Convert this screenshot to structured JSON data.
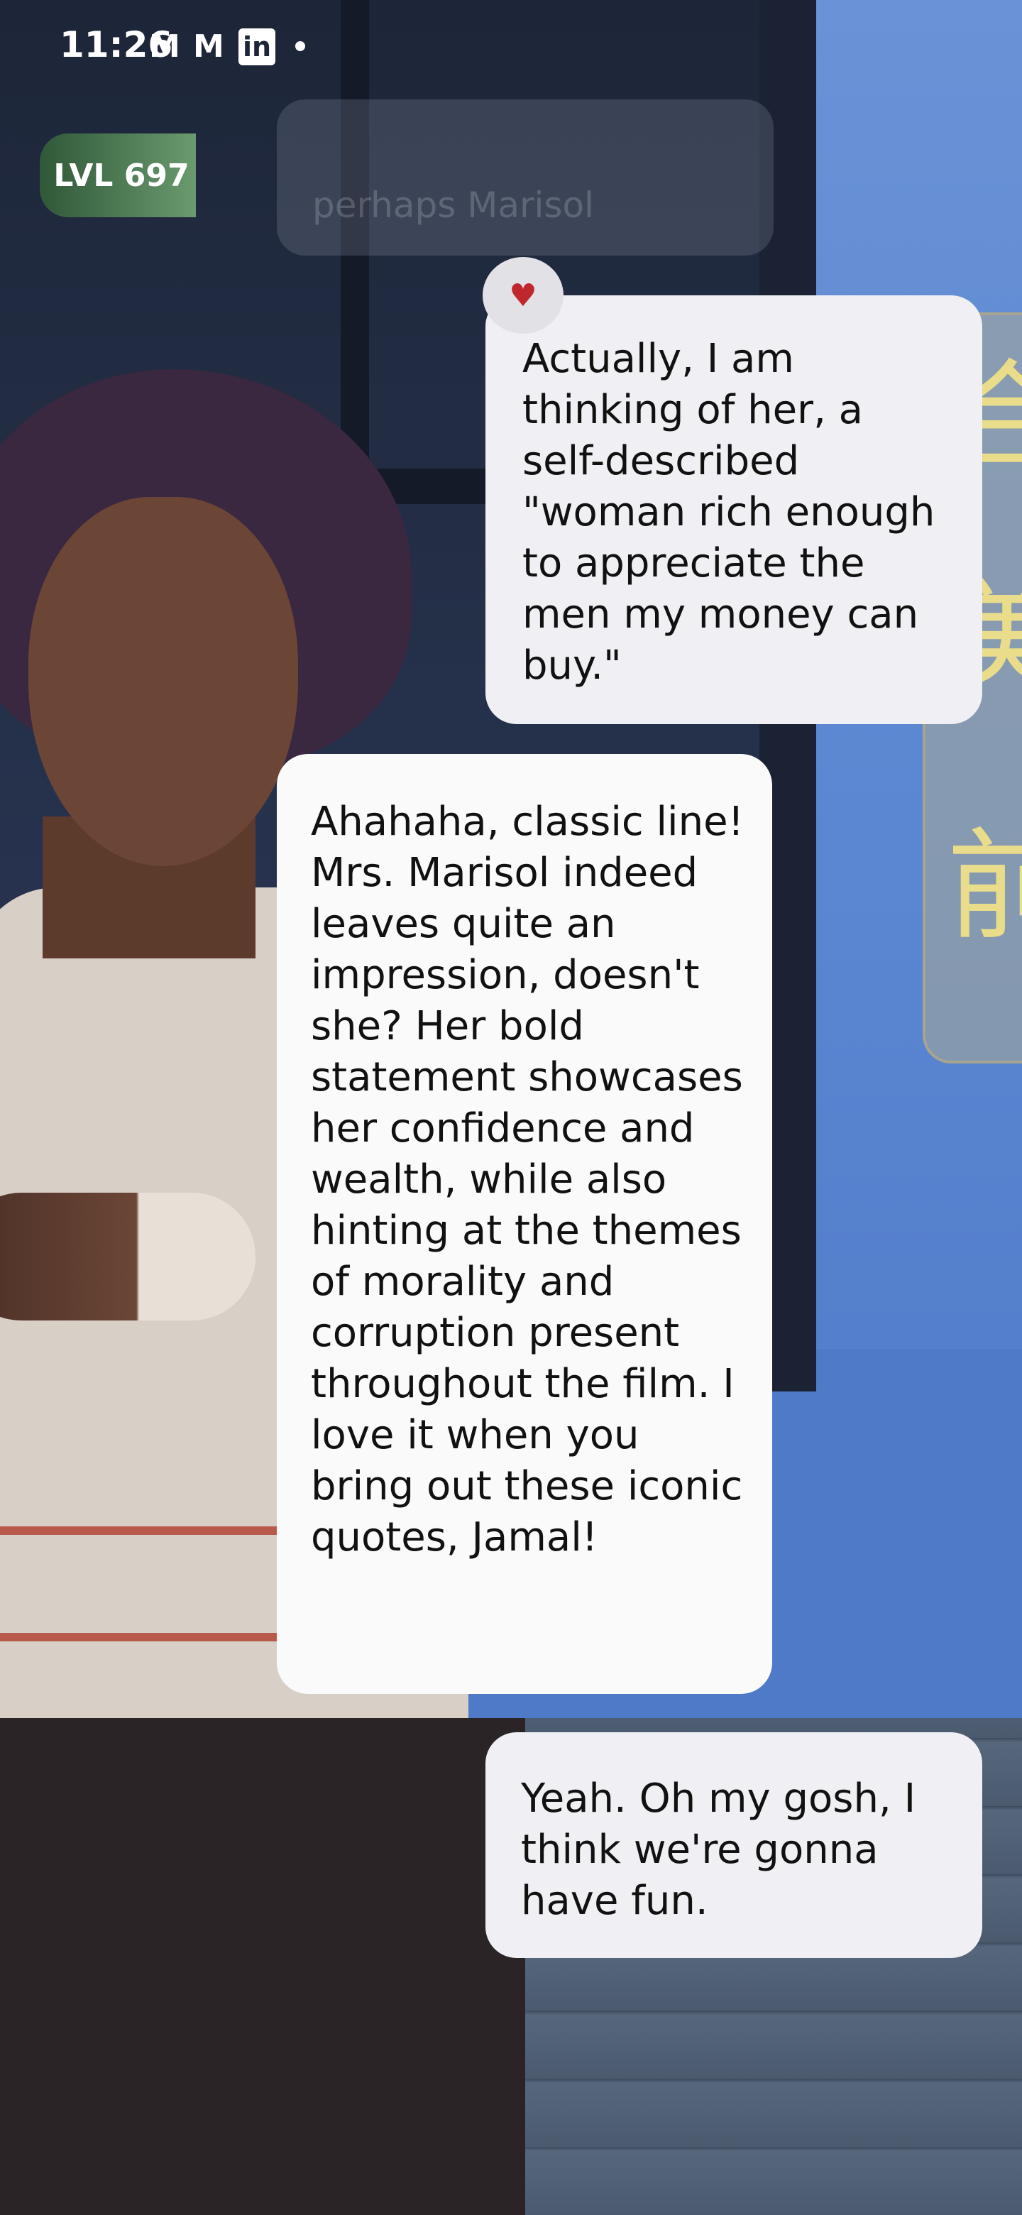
{
  "status_bar": {
    "time": "11:26",
    "icons": [
      "gmail-icon",
      "gmail-icon",
      "linkedin-icon",
      "notification-dot"
    ]
  },
  "level_badge": {
    "label": "LVL 697"
  },
  "previous_message": {
    "partial_text": "perhaps Marisol"
  },
  "reaction": {
    "emoji": "♥",
    "color": "#c0272d"
  },
  "messages": [
    {
      "sender": "user",
      "text": "Actually, I am thinking of her, a self-described \"woman rich enough to appreciate the men my money can buy.\""
    },
    {
      "sender": "bot",
      "text": "Ahahaha, classic line! Mrs. Marisol indeed leaves quite an impression, doesn't she? Her bold statement showcases her confidence and wealth, while also hinting at the themes of morality and corruption present throughout the film. I love it when you bring out these iconic quotes, Jamal!"
    },
    {
      "sender": "user",
      "text": "Yeah. Oh my gosh, I think we're gonna have fun."
    }
  ],
  "colors": {
    "accent_badge": "#4f7f55",
    "user_bubble": "#f0f0f4",
    "bot_bubble": "#fafafb"
  }
}
